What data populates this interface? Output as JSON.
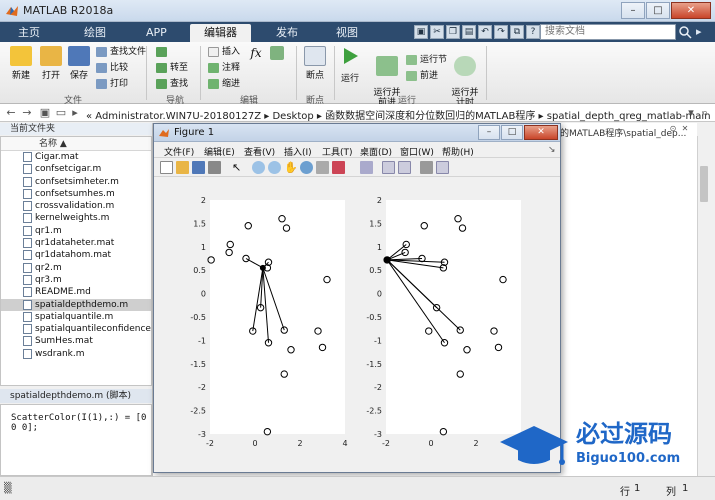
{
  "app": {
    "title": "MATLAB R2018a",
    "win_btns": [
      "–",
      "□",
      "✕"
    ]
  },
  "tabs": [
    "主页",
    "绘图",
    "APP",
    "编辑器",
    "发布",
    "视图"
  ],
  "search": {
    "placeholder": "搜索文档"
  },
  "tabbar_right": "▸",
  "ribbon": {
    "buttons": {
      "new": "新建",
      "open": "打开",
      "save": "保存",
      "breakpoints": "断点",
      "run": "运行",
      "run_advance": "运行并\n前进",
      "run_time": "运行并\n计时"
    },
    "small": {
      "find_files": "查找文件",
      "compare": "比较",
      "print": "打印",
      "goto": "转至",
      "find": "查找",
      "insert": "插入",
      "comment": "注释",
      "indent": "缩进",
      "run_section": "运行节",
      "advance": "前进"
    },
    "group_labels": {
      "file": "文件",
      "nav": "导航",
      "edit": "编辑",
      "bp": "断点",
      "run": "运行"
    }
  },
  "address": {
    "path": "«  Administrator.WIN7U-20180127Z  ▸  Desktop  ▸  函数数据空间深度和分位数回归的MATLAB程序  ▸  spatial_depth_qreg_matlab-main"
  },
  "current_folder": {
    "title": "当前文件夹",
    "col_name": "名称 ▲"
  },
  "files": [
    "Cigar.mat",
    "confsetcigar.m",
    "confsetsimheter.m",
    "confsetsumhes.m",
    "crossvalidation.m",
    "kernelweights.m",
    "qr1.m",
    "qr1dataheter.mat",
    "qr1datahom.mat",
    "qr2.m",
    "qr3.m",
    "README.md",
    "spatialdepthdemo.m",
    "spatialquantile.m",
    "spatialquantileconfidenceset.m",
    "SumHes.mat",
    "wsdrank.m"
  ],
  "selected_file_index": 12,
  "editor": {
    "script_header": "spatialdepthdemo.m  (脚本)",
    "code_line": "ScatterColor(I(1),:) = [0 0 0];",
    "tab_text": "的MATLAB程序\\spatial_dep..."
  },
  "status": {
    "line_label": "行",
    "line_value": "1",
    "col_label": "列",
    "col_value": "1"
  },
  "figure": {
    "title": "Figure 1",
    "menu": [
      "文件(F)",
      "编辑(E)",
      "查看(V)",
      "插入(I)",
      "工具(T)",
      "桌面(D)",
      "窗口(W)",
      "帮助(H)"
    ]
  },
  "logo": {
    "text": "必过源码",
    "url": "Biguo100.com"
  },
  "chart_data": [
    {
      "type": "scatter",
      "title": "",
      "xlabel": "",
      "ylabel": "",
      "xlim": [
        -2,
        4
      ],
      "ylim": [
        -3,
        2
      ],
      "xticks": [
        -2,
        0,
        2,
        4
      ],
      "yticks": [
        2,
        1.5,
        1,
        0.5,
        0,
        -0.5,
        -1,
        -1.5,
        -2,
        -2.5,
        -3
      ],
      "points": [
        [
          -1.95,
          0.72
        ],
        [
          -1.1,
          1.05
        ],
        [
          -1.15,
          0.88
        ],
        [
          -0.3,
          1.45
        ],
        [
          0.6,
          0.67
        ],
        [
          1.2,
          1.6
        ],
        [
          1.4,
          1.4
        ],
        [
          -0.4,
          0.75
        ],
        [
          0.55,
          0.55
        ],
        [
          3.2,
          0.3
        ],
        [
          0.25,
          -0.3
        ],
        [
          -0.1,
          -0.8
        ],
        [
          0.6,
          -1.05
        ],
        [
          1.3,
          -0.78
        ],
        [
          1.6,
          -1.2
        ],
        [
          2.8,
          -0.8
        ],
        [
          3.0,
          -1.15
        ],
        [
          1.3,
          -1.72
        ],
        [
          0.55,
          -2.95
        ]
      ],
      "center": [
        0.35,
        0.55
      ],
      "lines_to": [
        [
          0.6,
          0.67
        ],
        [
          0.25,
          -0.3
        ],
        [
          -0.1,
          -0.8
        ],
        [
          0.6,
          -1.05
        ],
        [
          1.3,
          -0.78
        ],
        [
          -0.4,
          0.75
        ]
      ]
    },
    {
      "type": "scatter",
      "title": "",
      "xlabel": "",
      "ylabel": "",
      "xlim": [
        -2,
        4
      ],
      "ylim": [
        -3,
        2
      ],
      "xticks": [
        -2,
        0,
        2,
        4
      ],
      "yticks": [
        2,
        1.5,
        1,
        0.5,
        0,
        -0.5,
        -1,
        -1.5,
        -2,
        -2.5,
        -3
      ],
      "points": [
        [
          -1.95,
          0.72
        ],
        [
          -1.1,
          1.05
        ],
        [
          -1.15,
          0.88
        ],
        [
          -0.3,
          1.45
        ],
        [
          0.6,
          0.67
        ],
        [
          1.2,
          1.6
        ],
        [
          1.4,
          1.4
        ],
        [
          -0.4,
          0.75
        ],
        [
          0.55,
          0.55
        ],
        [
          3.2,
          0.3
        ],
        [
          0.25,
          -0.3
        ],
        [
          -0.1,
          -0.8
        ],
        [
          0.6,
          -1.05
        ],
        [
          1.3,
          -0.78
        ],
        [
          1.6,
          -1.2
        ],
        [
          2.8,
          -0.8
        ],
        [
          3.0,
          -1.15
        ],
        [
          1.3,
          -1.72
        ],
        [
          0.55,
          -2.95
        ]
      ],
      "center": [
        -1.95,
        0.72
      ],
      "lines_to": [
        [
          -1.1,
          1.05
        ],
        [
          -1.15,
          0.88
        ],
        [
          -0.4,
          0.75
        ],
        [
          0.55,
          0.55
        ],
        [
          0.6,
          0.67
        ],
        [
          0.25,
          -0.3
        ],
        [
          1.3,
          -0.78
        ],
        [
          0.6,
          -1.05
        ]
      ]
    }
  ]
}
